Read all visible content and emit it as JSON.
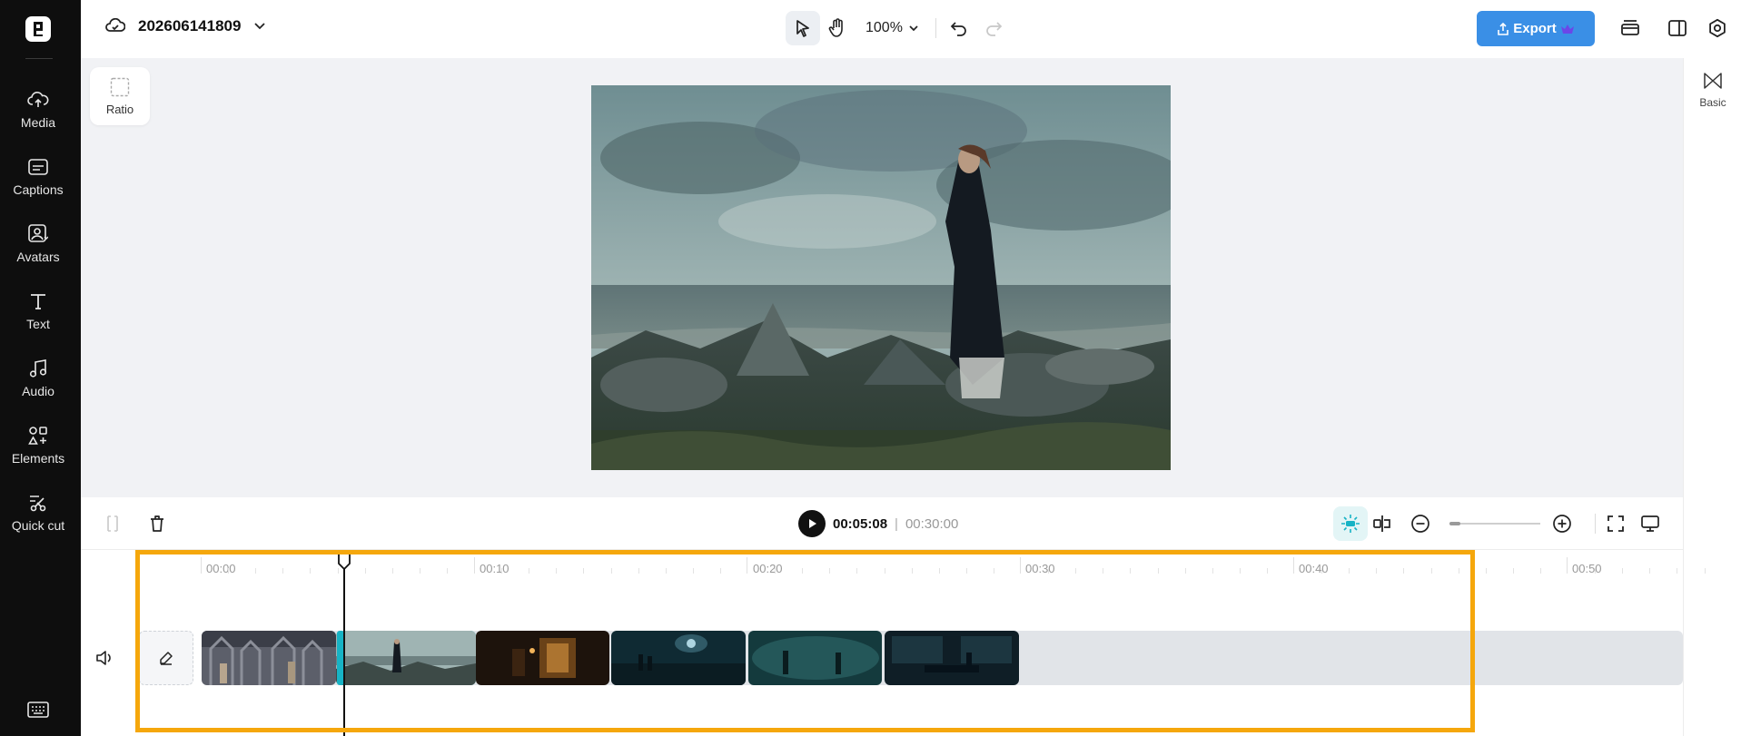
{
  "sidebar": {
    "items": [
      {
        "label": "Media",
        "icon": "cloud-upload-icon"
      },
      {
        "label": "Captions",
        "icon": "captions-icon"
      },
      {
        "label": "Avatars",
        "icon": "avatar-icon"
      },
      {
        "label": "Text",
        "icon": "text-icon"
      },
      {
        "label": "Audio",
        "icon": "music-note-icon"
      },
      {
        "label": "Elements",
        "icon": "elements-icon"
      },
      {
        "label": "Quick cut",
        "icon": "scissors-icon"
      }
    ]
  },
  "header": {
    "project_name": "202606141809",
    "zoom": "100%",
    "export_label": "Export"
  },
  "canvas": {
    "ratio_label": "Ratio"
  },
  "right_panel": {
    "basic_label": "Basic"
  },
  "timeline": {
    "current_time": "00:05:08",
    "separator": "|",
    "total_time": "00:30:00",
    "ruler": [
      "00:00",
      "00:10",
      "00:20",
      "00:30",
      "00:40",
      "00:50"
    ],
    "clips": [
      {
        "name": "clip-cathedral"
      },
      {
        "name": "clip-woman-rocks"
      },
      {
        "name": "clip-dim-hallway"
      },
      {
        "name": "clip-night-street"
      },
      {
        "name": "clip-figures-fog"
      },
      {
        "name": "clip-dark-office"
      }
    ]
  },
  "colors": {
    "accent": "#3a8fe6",
    "selection": "#17b3c5",
    "highlight": "#f5a70c"
  }
}
